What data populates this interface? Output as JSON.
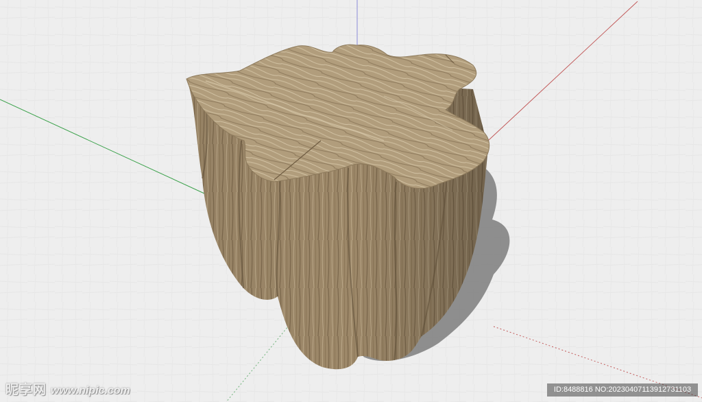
{
  "scene": {
    "model": "tree-stump-wooden-stool",
    "background_color": "#eeeeee",
    "axis_colors": {
      "blue": "#8a8ad8",
      "red": "#c25a5a",
      "green": "#3aa14a"
    },
    "wood_colors": {
      "top": "#b19d7c",
      "side": "#9a8567",
      "shadow": "#7c7c7c"
    }
  },
  "watermark": {
    "site_name": "昵享网",
    "url": "www.nipic.com",
    "id_text": "ID:8488816 NO:20230407113912731103"
  }
}
